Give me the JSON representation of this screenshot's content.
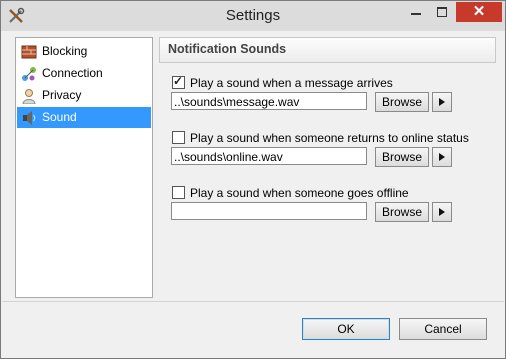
{
  "window": {
    "title": "Settings",
    "close_glyph": "✕"
  },
  "sidebar": {
    "items": [
      {
        "label": "Blocking",
        "icon": "blocking-icon"
      },
      {
        "label": "Connection",
        "icon": "connection-icon"
      },
      {
        "label": "Privacy",
        "icon": "privacy-icon"
      },
      {
        "label": "Sound",
        "icon": "sound-icon",
        "selected": true
      }
    ]
  },
  "panel": {
    "title": "Notification Sounds",
    "sounds": [
      {
        "label": "Play a sound when a message arrives",
        "checked": true,
        "path": "..\\sounds\\message.wav",
        "browse": "Browse"
      },
      {
        "label": "Play a sound when someone returns to online status",
        "checked": false,
        "path": "..\\sounds\\online.wav",
        "browse": "Browse"
      },
      {
        "label": "Play a sound when someone goes offline",
        "checked": false,
        "path": "",
        "browse": "Browse"
      }
    ]
  },
  "footer": {
    "ok": "OK",
    "cancel": "Cancel"
  }
}
